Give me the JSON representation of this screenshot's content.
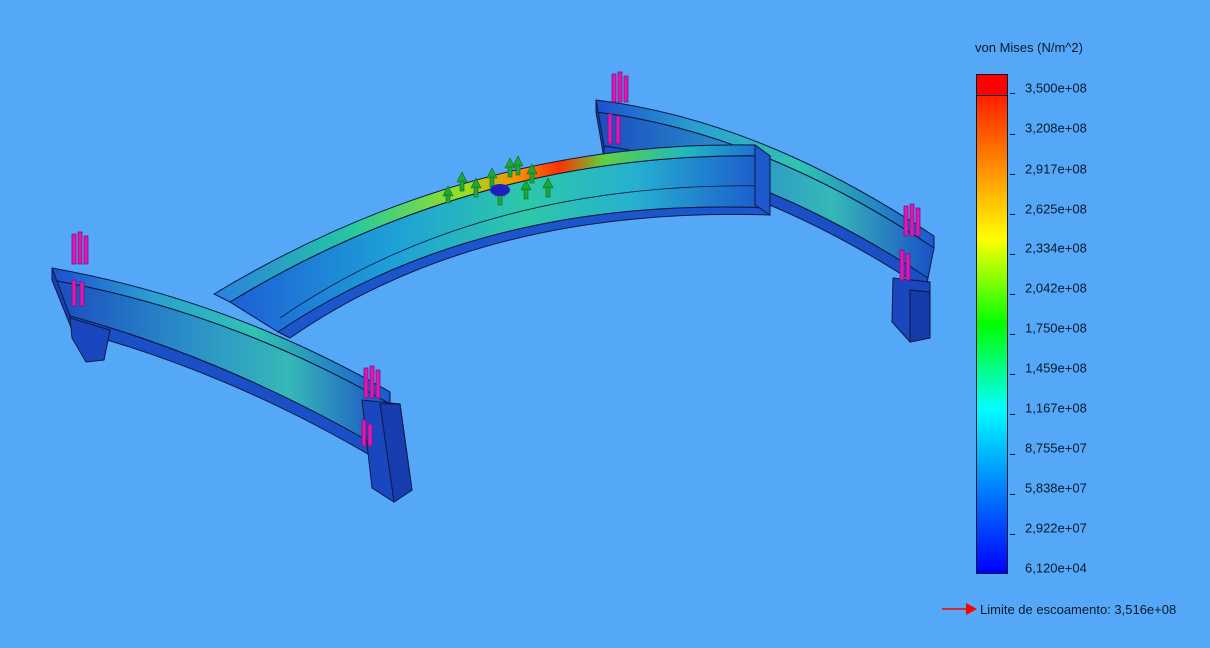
{
  "legend": {
    "title": "von Mises (N/m^2)",
    "ticks": [
      "3,500e+08",
      "3,208e+08",
      "2,917e+08",
      "2,625e+08",
      "2,334e+08",
      "2,042e+08",
      "1,750e+08",
      "1,459e+08",
      "1,167e+08",
      "8,755e+07",
      "5,838e+07",
      "2,922e+07",
      "6,120e+04"
    ],
    "colors": {
      "max": "#ff0000",
      "orange": "#ff8000",
      "yellow": "#ffff00",
      "green": "#00ff00",
      "cyan": "#00ffff",
      "blue": "#0080ff",
      "min": "#0000ff"
    }
  },
  "yield": {
    "text": "Limite de escoamento: 3,516e+08",
    "arrow_color": "#ff0000"
  },
  "model": {
    "fixture_color": "#d81bb8",
    "load_color": "#1ea83a"
  }
}
